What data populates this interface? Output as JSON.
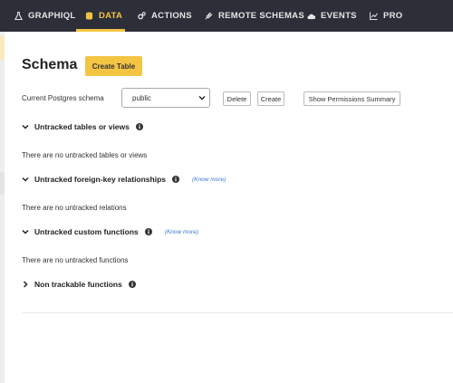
{
  "nav": {
    "items": [
      {
        "label": "GRAPHIQL",
        "icon": "flask-icon"
      },
      {
        "label": "DATA",
        "icon": "database-icon"
      },
      {
        "label": "ACTIONS",
        "icon": "cogs-icon"
      },
      {
        "label": "REMOTE SCHEMAS",
        "icon": "plug-icon"
      },
      {
        "label": "EVENTS",
        "icon": "cloud-icon"
      },
      {
        "label": "PRO",
        "icon": "chart-icon"
      }
    ],
    "active": "DATA",
    "accent_color": "#f4c543",
    "background_color": "#2c2f38"
  },
  "page": {
    "title": "Schema",
    "create_table_label": "Create Table"
  },
  "schema_bar": {
    "label": "Current Postgres schema",
    "selected": "public",
    "delete_label": "Delete",
    "create_label": "Create",
    "permissions_label": "Show Permissions Summary"
  },
  "sections": [
    {
      "title": "Untracked tables or views",
      "empty_text": "There are no untracked tables or views",
      "know_more": ""
    },
    {
      "title": "Untracked foreign-key relationships",
      "empty_text": "There are no untracked relations",
      "know_more": "(Know more)"
    },
    {
      "title": "Untracked custom functions",
      "empty_text": "There are no untracked functions",
      "know_more": "(Know more)"
    },
    {
      "title": "Non trackable functions",
      "empty_text": "",
      "know_more": ""
    }
  ]
}
